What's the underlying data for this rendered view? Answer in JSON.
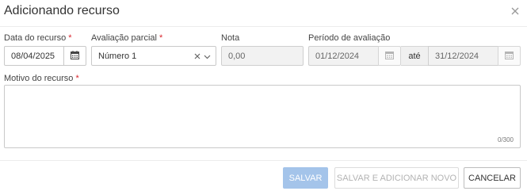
{
  "dialog": {
    "title": "Adicionando recurso",
    "close_icon": "close-icon"
  },
  "form": {
    "date": {
      "label": "Data do recurso",
      "required_mark": "*",
      "value": "08/04/2025",
      "icon": "calendar-icon"
    },
    "partial_eval": {
      "label": "Avaliação parcial",
      "required_mark": "*",
      "selected": "Número 1",
      "clear_icon": "clear-icon",
      "dropdown_icon": "chevron-down-icon"
    },
    "grade": {
      "label": "Nota",
      "value": "0,00"
    },
    "period": {
      "label": "Período de avaliação",
      "start": "01/12/2024",
      "separator": "até",
      "end": "31/12/2024",
      "icon": "calendar-icon"
    },
    "reason": {
      "label": "Motivo do recurso",
      "required_mark": "*",
      "value": "",
      "counter": "0/300"
    }
  },
  "footer": {
    "save_label": "SALVAR",
    "save_new_label": "SALVAR E ADICIONAR NOVO",
    "cancel_label": "CANCELAR"
  },
  "colors": {
    "required": "#d9262d",
    "primary_disabled": "#a4c4ea",
    "border": "#c9c9c9",
    "disabled_bg": "#f2f2f2"
  }
}
